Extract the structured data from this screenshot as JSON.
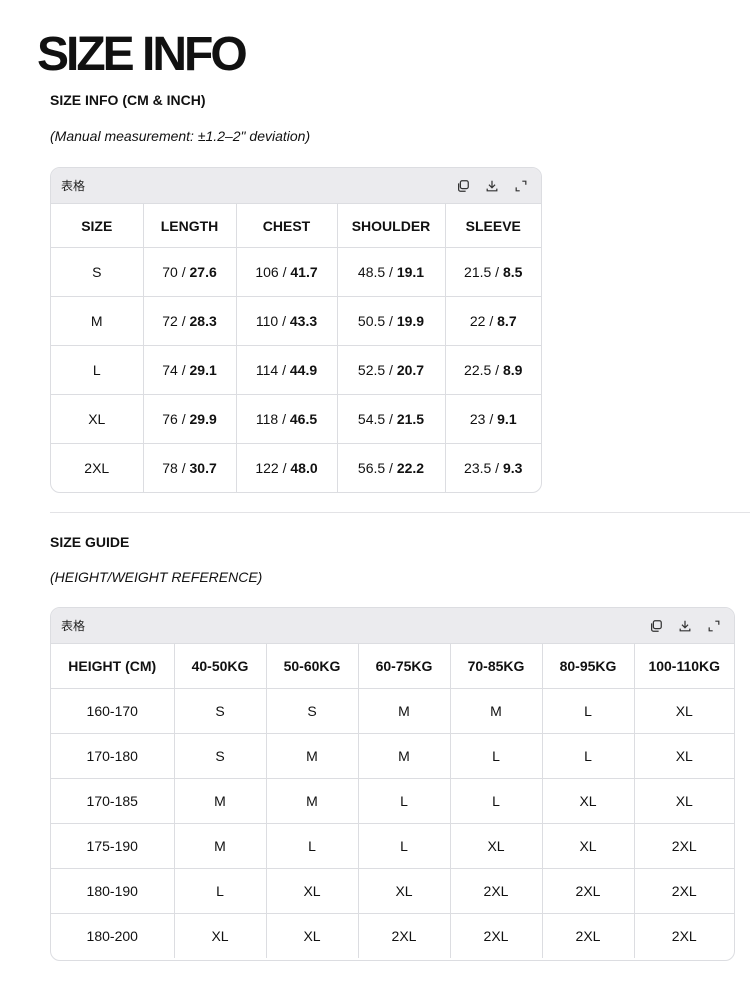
{
  "page_title": "SIZE INFO",
  "size_info": {
    "title": "SIZE INFO (CM & INCH)",
    "note": "(Manual measurement: ±1.2–2\" deviation)",
    "card_label": "表格",
    "headers": [
      "SIZE",
      "LENGTH",
      "CHEST",
      "SHOULDER",
      "SLEEVE"
    ],
    "rows": [
      [
        "S",
        [
          "70",
          "27.6"
        ],
        [
          "106",
          "41.7"
        ],
        [
          "48.5",
          "19.1"
        ],
        [
          "21.5",
          "8.5"
        ]
      ],
      [
        "M",
        [
          "72",
          "28.3"
        ],
        [
          "110",
          "43.3"
        ],
        [
          "50.5",
          "19.9"
        ],
        [
          "22",
          "8.7"
        ]
      ],
      [
        "L",
        [
          "74",
          "29.1"
        ],
        [
          "114",
          "44.9"
        ],
        [
          "52.5",
          "20.7"
        ],
        [
          "22.5",
          "8.9"
        ]
      ],
      [
        "XL",
        [
          "76",
          "29.9"
        ],
        [
          "118",
          "46.5"
        ],
        [
          "54.5",
          "21.5"
        ],
        [
          "23",
          "9.1"
        ]
      ],
      [
        "2XL",
        [
          "78",
          "30.7"
        ],
        [
          "122",
          "48.0"
        ],
        [
          "56.5",
          "22.2"
        ],
        [
          "23.5",
          "9.3"
        ]
      ]
    ]
  },
  "size_guide": {
    "title": "SIZE GUIDE",
    "note": "(HEIGHT/WEIGHT REFERENCE)",
    "card_label": "表格",
    "headers": [
      "HEIGHT (CM)",
      "40-50KG",
      "50-60KG",
      "60-75KG",
      "70-85KG",
      "80-95KG",
      "100-110KG"
    ],
    "rows": [
      [
        "160-170",
        "S",
        "S",
        "M",
        "M",
        "L",
        "XL"
      ],
      [
        "170-180",
        "S",
        "M",
        "M",
        "L",
        "L",
        "XL"
      ],
      [
        "170-185",
        "M",
        "M",
        "L",
        "L",
        "XL",
        "XL"
      ],
      [
        "175-190",
        "M",
        "L",
        "L",
        "XL",
        "XL",
        "2XL"
      ],
      [
        "180-190",
        "L",
        "XL",
        "XL",
        "2XL",
        "2XL",
        "2XL"
      ],
      [
        "180-200",
        "XL",
        "XL",
        "2XL",
        "2XL",
        "2XL",
        "2XL"
      ]
    ]
  },
  "tool_icons": [
    "copy-icon",
    "download-icon",
    "expand-icon"
  ]
}
